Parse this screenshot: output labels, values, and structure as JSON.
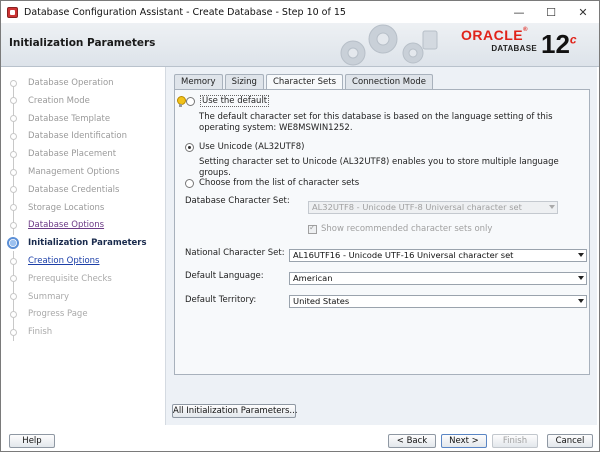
{
  "window": {
    "title": "Database Configuration Assistant - Create Database - Step 10 of 15",
    "minimize": "—",
    "maximize": "☐",
    "close": "✕"
  },
  "header": {
    "title": "Initialization Parameters",
    "brand": "ORACLE",
    "brand_registered": "®",
    "product": "DATABASE",
    "version": "12",
    "version_suffix": "c"
  },
  "nav": {
    "items": [
      {
        "label": "Database Operation",
        "state": "done"
      },
      {
        "label": "Creation Mode",
        "state": "done"
      },
      {
        "label": "Database Template",
        "state": "done"
      },
      {
        "label": "Database Identification",
        "state": "done"
      },
      {
        "label": "Database Placement",
        "state": "done"
      },
      {
        "label": "Management Options",
        "state": "done"
      },
      {
        "label": "Database Credentials",
        "state": "done"
      },
      {
        "label": "Storage Locations",
        "state": "done"
      },
      {
        "label": "Database Options",
        "state": "link-visited"
      },
      {
        "label": "Initialization Parameters",
        "state": "current"
      },
      {
        "label": "Creation Options",
        "state": "link"
      },
      {
        "label": "Prerequisite Checks",
        "state": "pending"
      },
      {
        "label": "Summary",
        "state": "pending"
      },
      {
        "label": "Progress Page",
        "state": "pending"
      },
      {
        "label": "Finish",
        "state": "pending"
      }
    ]
  },
  "tabs": [
    "Memory",
    "Sizing",
    "Character Sets",
    "Connection Mode"
  ],
  "active_tab": "Character Sets",
  "charset": {
    "option_default": "Use the default",
    "option_default_desc": "The default character set for this database is based on the language setting of this operating system: WE8MSWIN1252.",
    "option_unicode": "Use Unicode (AL32UTF8)",
    "option_unicode_desc": "Setting character set to Unicode (AL32UTF8) enables you to store multiple language groups.",
    "option_list": "Choose from the list of character sets",
    "selected": "unicode",
    "db_charset_label": "Database Character Set:",
    "db_charset_value": "AL32UTF8 - Unicode UTF-8 Universal character set",
    "show_recommended": "Show recommended character sets only",
    "national_label": "National Character Set:",
    "national_value": "AL16UTF16 - Unicode UTF-16 Universal character set",
    "language_label": "Default Language:",
    "language_value": "American",
    "territory_label": "Default Territory:",
    "territory_value": "United States"
  },
  "buttons": {
    "all_params": "All Initialization Parameters...",
    "help": "Help",
    "back": "< Back",
    "next": "Next >",
    "finish": "Finish",
    "cancel": "Cancel"
  }
}
